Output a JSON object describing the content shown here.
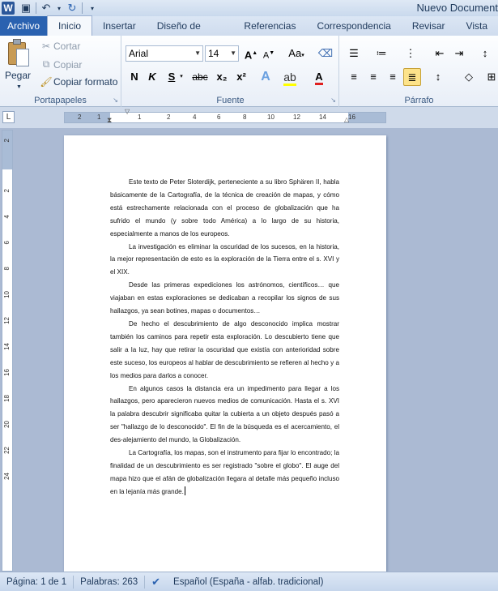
{
  "window": {
    "title": "Nuevo Document"
  },
  "tabs": [
    {
      "label": "Archivo"
    },
    {
      "label": "Inicio"
    },
    {
      "label": "Insertar"
    },
    {
      "label": "Diseño de página"
    },
    {
      "label": "Referencias"
    },
    {
      "label": "Correspondencia"
    },
    {
      "label": "Revisar"
    },
    {
      "label": "Vista"
    }
  ],
  "ribbon": {
    "clipboard": {
      "label": "Portapapeles",
      "paste": "Pegar",
      "cut": "Cortar",
      "copy": "Copiar",
      "format_painter": "Copiar formato"
    },
    "font": {
      "label": "Fuente",
      "family": "Arial",
      "size": "14",
      "bold": "N",
      "italic": "K",
      "underline": "S",
      "strike": "abc",
      "subscript": "x₂",
      "superscript": "x²",
      "grow": "A",
      "shrink": "A",
      "case": "Aa",
      "font_color": "A"
    },
    "paragraph": {
      "label": "Párrafo"
    }
  },
  "ruler": {
    "h_ticks": [
      "2",
      "1",
      "1",
      "2",
      "4",
      "6",
      "8",
      "10",
      "12",
      "14",
      "16"
    ],
    "v_ticks": [
      "2",
      "2",
      "4",
      "6",
      "8",
      "10",
      "12",
      "14",
      "16",
      "18",
      "20",
      "22",
      "24"
    ]
  },
  "document": {
    "paragraphs": [
      "Este texto de Peter Sloterdijk, perteneciente a su libro Sphären II, habla básicamente de la Cartografía, de la técnica de creación de mapas, y cómo está estrechamente relacionada con el proceso de globalización que ha sufrido el mundo (y sobre todo América) a lo largo de su historia, especialmente a manos de los europeos.",
      "La investigación es eliminar la oscuridad de los sucesos, en la historia, la mejor representación de esto es la exploración de la Tierra entre el  s. XVI y el XIX.",
      "Desde las primeras expediciones los astrónomos, científicos… que viajaban en estas exploraciones se dedicaban a recopilar los signos de sus hallazgos, ya sean botines, mapas o documentos…",
      "De hecho el descubrimiento de algo desconocido implica mostrar también los caminos para repetir esta exploración. Lo descubierto tiene que salir a la luz, hay que retirar la oscuridad que existía con anterioridad sobre este suceso, los europeos al hablar de descubrimiento se refieren al hecho y a los medios para darlos a conocer.",
      "En algunos casos la distancia era un impedimento para llegar a los hallazgos, pero aparecieron nuevos medios de comunicación. Hasta el s. XVI la palabra descubrir significaba quitar la cubierta  a un objeto después pasó a ser \"hallazgo de lo desconocido\". El fin de la búsqueda es el acercamiento, el des-alejamiento del mundo, la Globalización.",
      "La Cartografía, los mapas, son el instrumento para fijar lo encontrado; la finalidad de un descubrimiento es ser registrado \"sobre el globo\".  El auge del mapa hizo que el afán de globalización llegara al detalle más pequeño incluso en la lejanía más grande."
    ]
  },
  "status": {
    "page": "Página: 1 de 1",
    "words": "Palabras: 263",
    "language": "Español (España - alfab. tradicional)"
  },
  "colors": {
    "file_tab": "#2a62b0",
    "ribbon_bg": "#e8eef7",
    "canvas": "#abbad3"
  }
}
